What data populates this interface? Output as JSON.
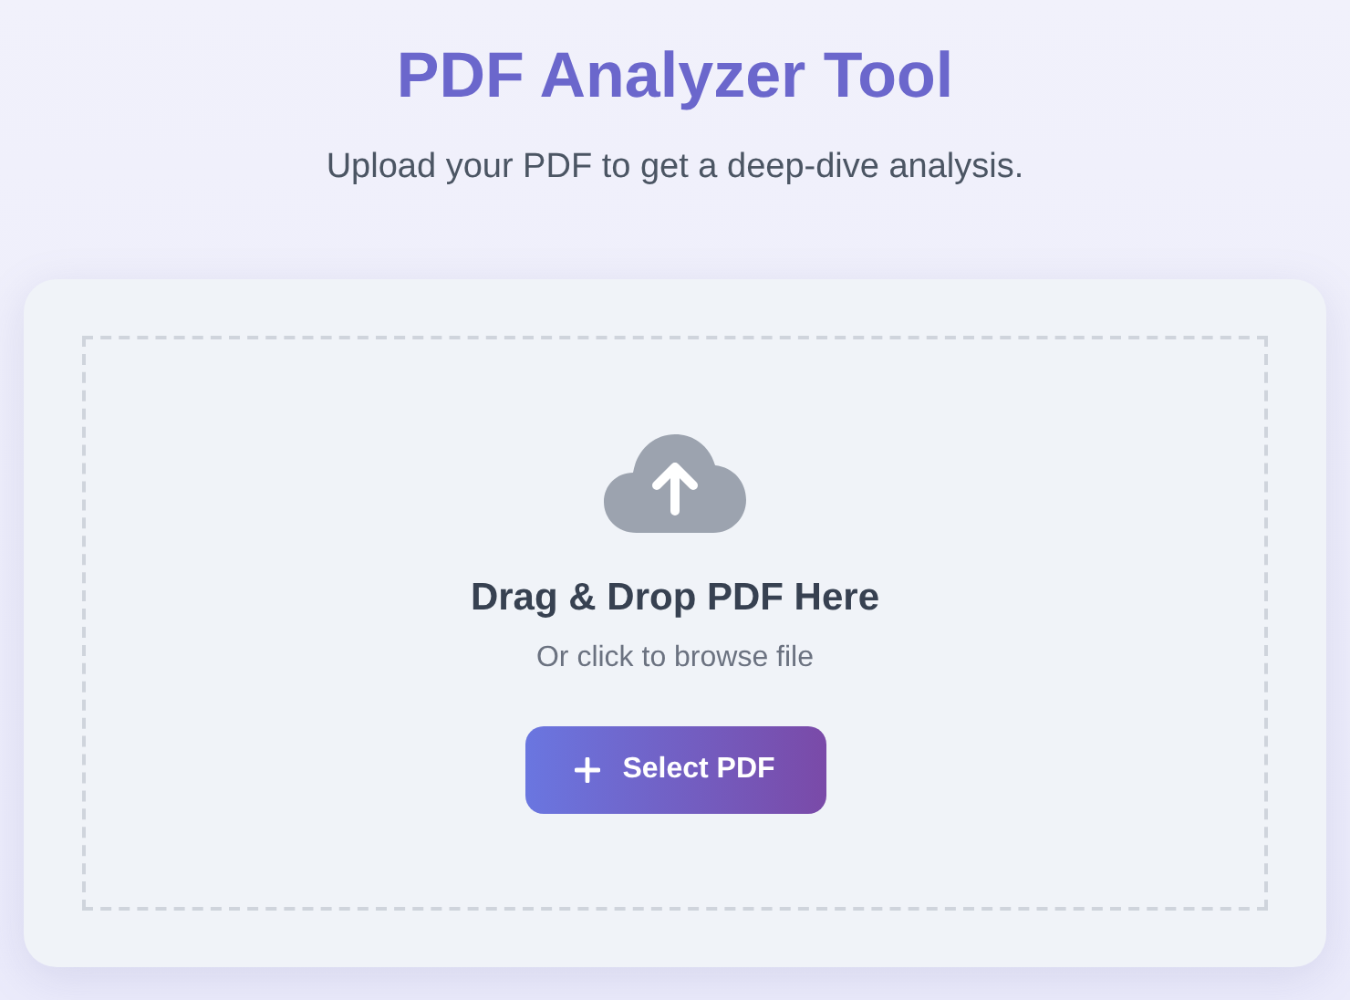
{
  "header": {
    "title": "PDF Analyzer Tool",
    "subtitle": "Upload your PDF to get a deep-dive analysis."
  },
  "dropzone": {
    "heading": "Drag & Drop PDF Here",
    "hint": "Or click to browse file",
    "button": "Select PDF"
  }
}
